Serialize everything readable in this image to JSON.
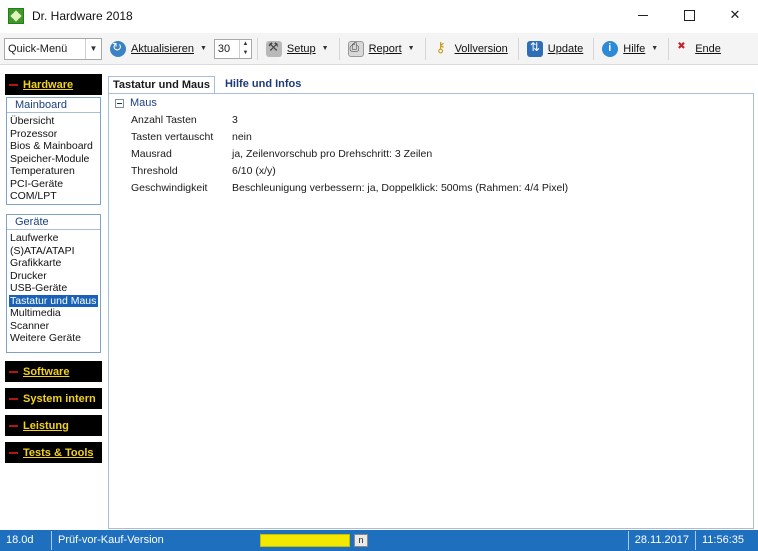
{
  "window": {
    "title": "Dr. Hardware 2018",
    "app_icon": "dr-hardware-logo-icon"
  },
  "toolbar": {
    "quick_menu": "Quick-Menü",
    "refresh_label": "Aktualisieren",
    "interval_value": "30",
    "setup_label": "Setup",
    "report_label": "Report",
    "full_version_label": "Vollversion",
    "update_label": "Update",
    "help_label": "Hilfe",
    "exit_label": "Ende"
  },
  "sidebar": {
    "categories": {
      "hardware": "Hardware",
      "software": "Software",
      "system": "System intern",
      "performance": "Leistung",
      "tests": "Tests & Tools"
    },
    "mainboard_group": {
      "title": "Mainboard",
      "items": [
        "Übersicht",
        "Prozessor",
        "Bios & Mainboard",
        "Speicher-Module",
        "Temperaturen",
        "PCI-Geräte",
        "COM/LPT"
      ]
    },
    "devices_group": {
      "title": "Geräte",
      "items": [
        "Laufwerke",
        "(S)ATA/ATAPI",
        "Grafikkarte",
        "Drucker",
        "USB-Geräte",
        "Tastatur und Maus",
        "Multimedia",
        "Scanner",
        "Weitere Geräte"
      ],
      "selected": "Tastatur und Maus"
    }
  },
  "main": {
    "tabs": [
      "Tastatur und Maus",
      "Hilfe und Infos"
    ],
    "active_tab": "Tastatur und Maus",
    "section_title": "Maus",
    "properties": [
      {
        "key": "Anzahl Tasten",
        "value": "3"
      },
      {
        "key": "Tasten vertauscht",
        "value": "nein"
      },
      {
        "key": "Mausrad",
        "value": "ja, Zeilenvorschub pro Drehschritt: 3 Zeilen"
      },
      {
        "key": "Threshold",
        "value": "6/10 (x/y)"
      },
      {
        "key": "Geschwindigkeit",
        "value": "Beschleunigung verbessern: ja, Doppelklick: 500ms (Rahmen: 4/4 Pixel)"
      }
    ]
  },
  "status": {
    "days": "18.0d",
    "mode": "Prüf-vor-Kauf-Version",
    "n_badge": "n",
    "date": "28.11.2017",
    "time": "11:56:35"
  },
  "colors": {
    "statusbar": "#1f6fbf",
    "category_bg": "#000000",
    "category_text": "#f2d21a",
    "selection": "#1a62b8",
    "group_header_text": "#1b3f80"
  }
}
